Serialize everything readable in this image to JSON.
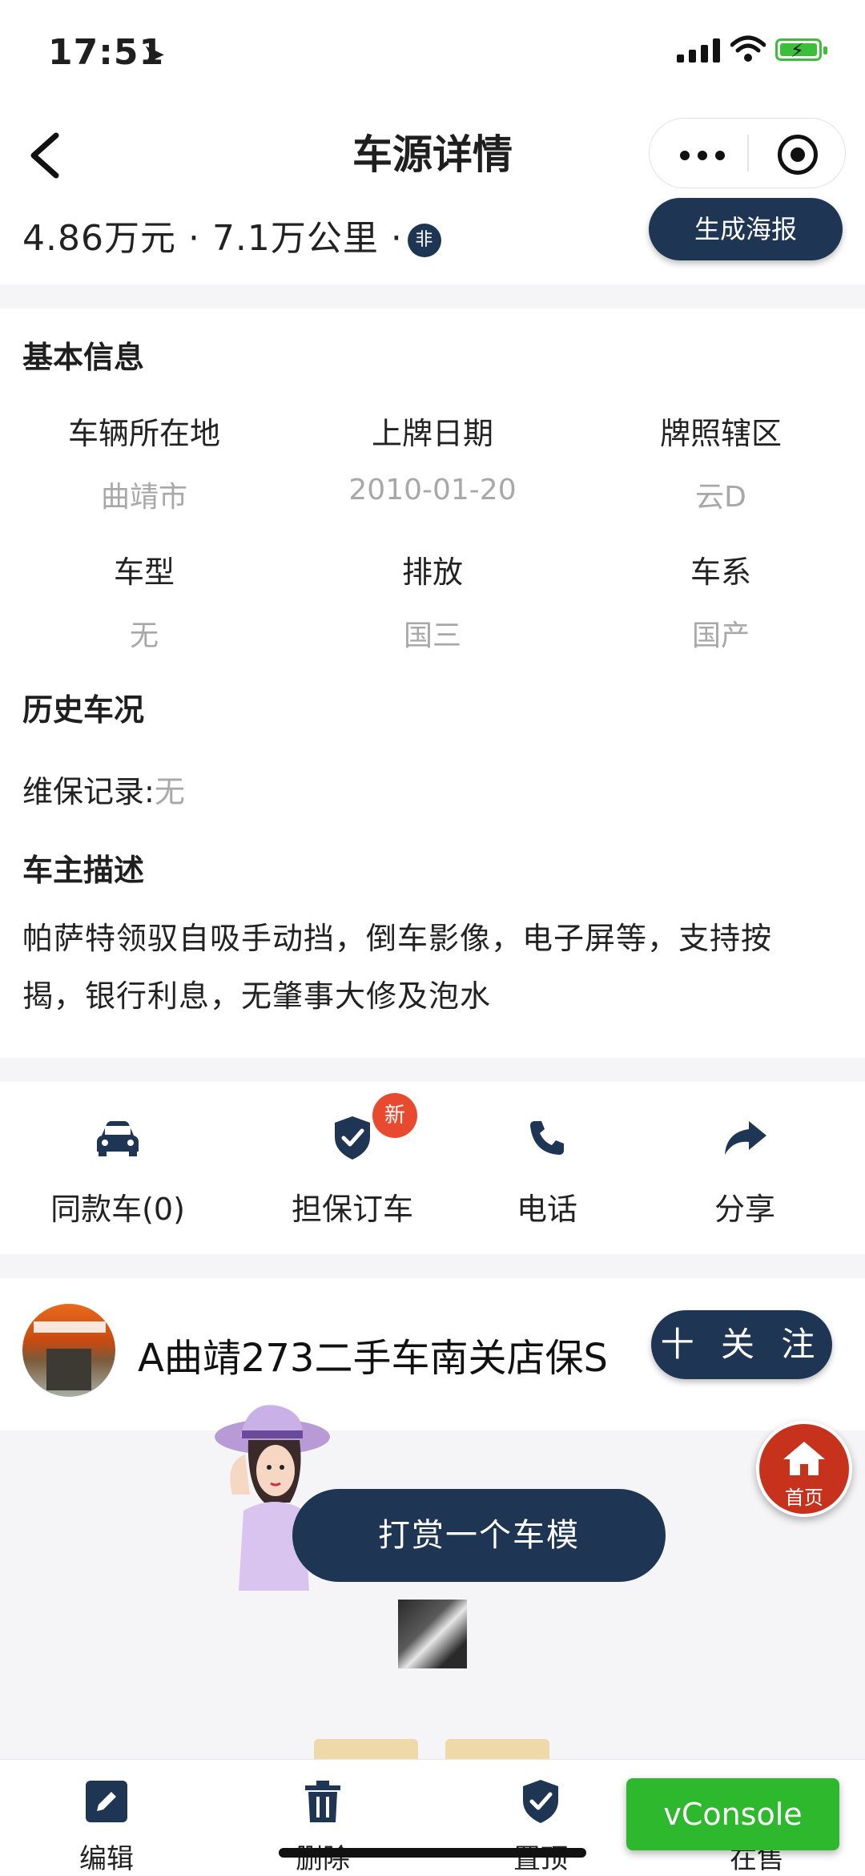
{
  "status": {
    "time": "17:51"
  },
  "nav": {
    "title": "车源详情"
  },
  "price_row": {
    "price": "4.86万元",
    "mileage": "7.1万公里",
    "badge": "非",
    "poster_button": "生成海报"
  },
  "basic_info": {
    "title": "基本信息",
    "cells": [
      {
        "label": "车辆所在地",
        "value": "曲靖市"
      },
      {
        "label": "上牌日期",
        "value": "2010-01-20"
      },
      {
        "label": "牌照辖区",
        "value": "云D"
      },
      {
        "label": "车型",
        "value": "无"
      },
      {
        "label": "排放",
        "value": "国三"
      },
      {
        "label": "车系",
        "value": "国产"
      }
    ]
  },
  "history": {
    "title": "历史车况",
    "maintenance_label": "维保记录:",
    "maintenance_value": "无"
  },
  "owner_desc": {
    "title": "车主描述",
    "text": "帕萨特领驭自吸手动挡，倒车影像，电子屏等，支持按揭，银行利息，无肇事大修及泡水"
  },
  "actions": [
    {
      "label": "同款车(0)",
      "icon": "car-icon"
    },
    {
      "label": "担保订车",
      "icon": "shield-check-icon",
      "badge": "新"
    },
    {
      "label": "电话",
      "icon": "phone-icon"
    },
    {
      "label": "分享",
      "icon": "share-arrow-icon"
    }
  ],
  "shop": {
    "name": "A曲靖273二手车南关店保S",
    "follow_label": "十 关 注"
  },
  "reward": {
    "button": "打赏一个车模"
  },
  "home_button": {
    "label": "首页"
  },
  "tabbar": [
    {
      "label": "编辑",
      "icon": "edit-icon"
    },
    {
      "label": "删除",
      "icon": "trash-icon"
    },
    {
      "label": "置顶",
      "icon": "shield-check-icon"
    },
    {
      "label": "在售",
      "icon": "circle-icon"
    }
  ],
  "vconsole": {
    "label": "vConsole"
  },
  "colors": {
    "navy": "#1f3554",
    "badge_red": "#e84a2f",
    "vconsole_green": "#2eb82e"
  }
}
